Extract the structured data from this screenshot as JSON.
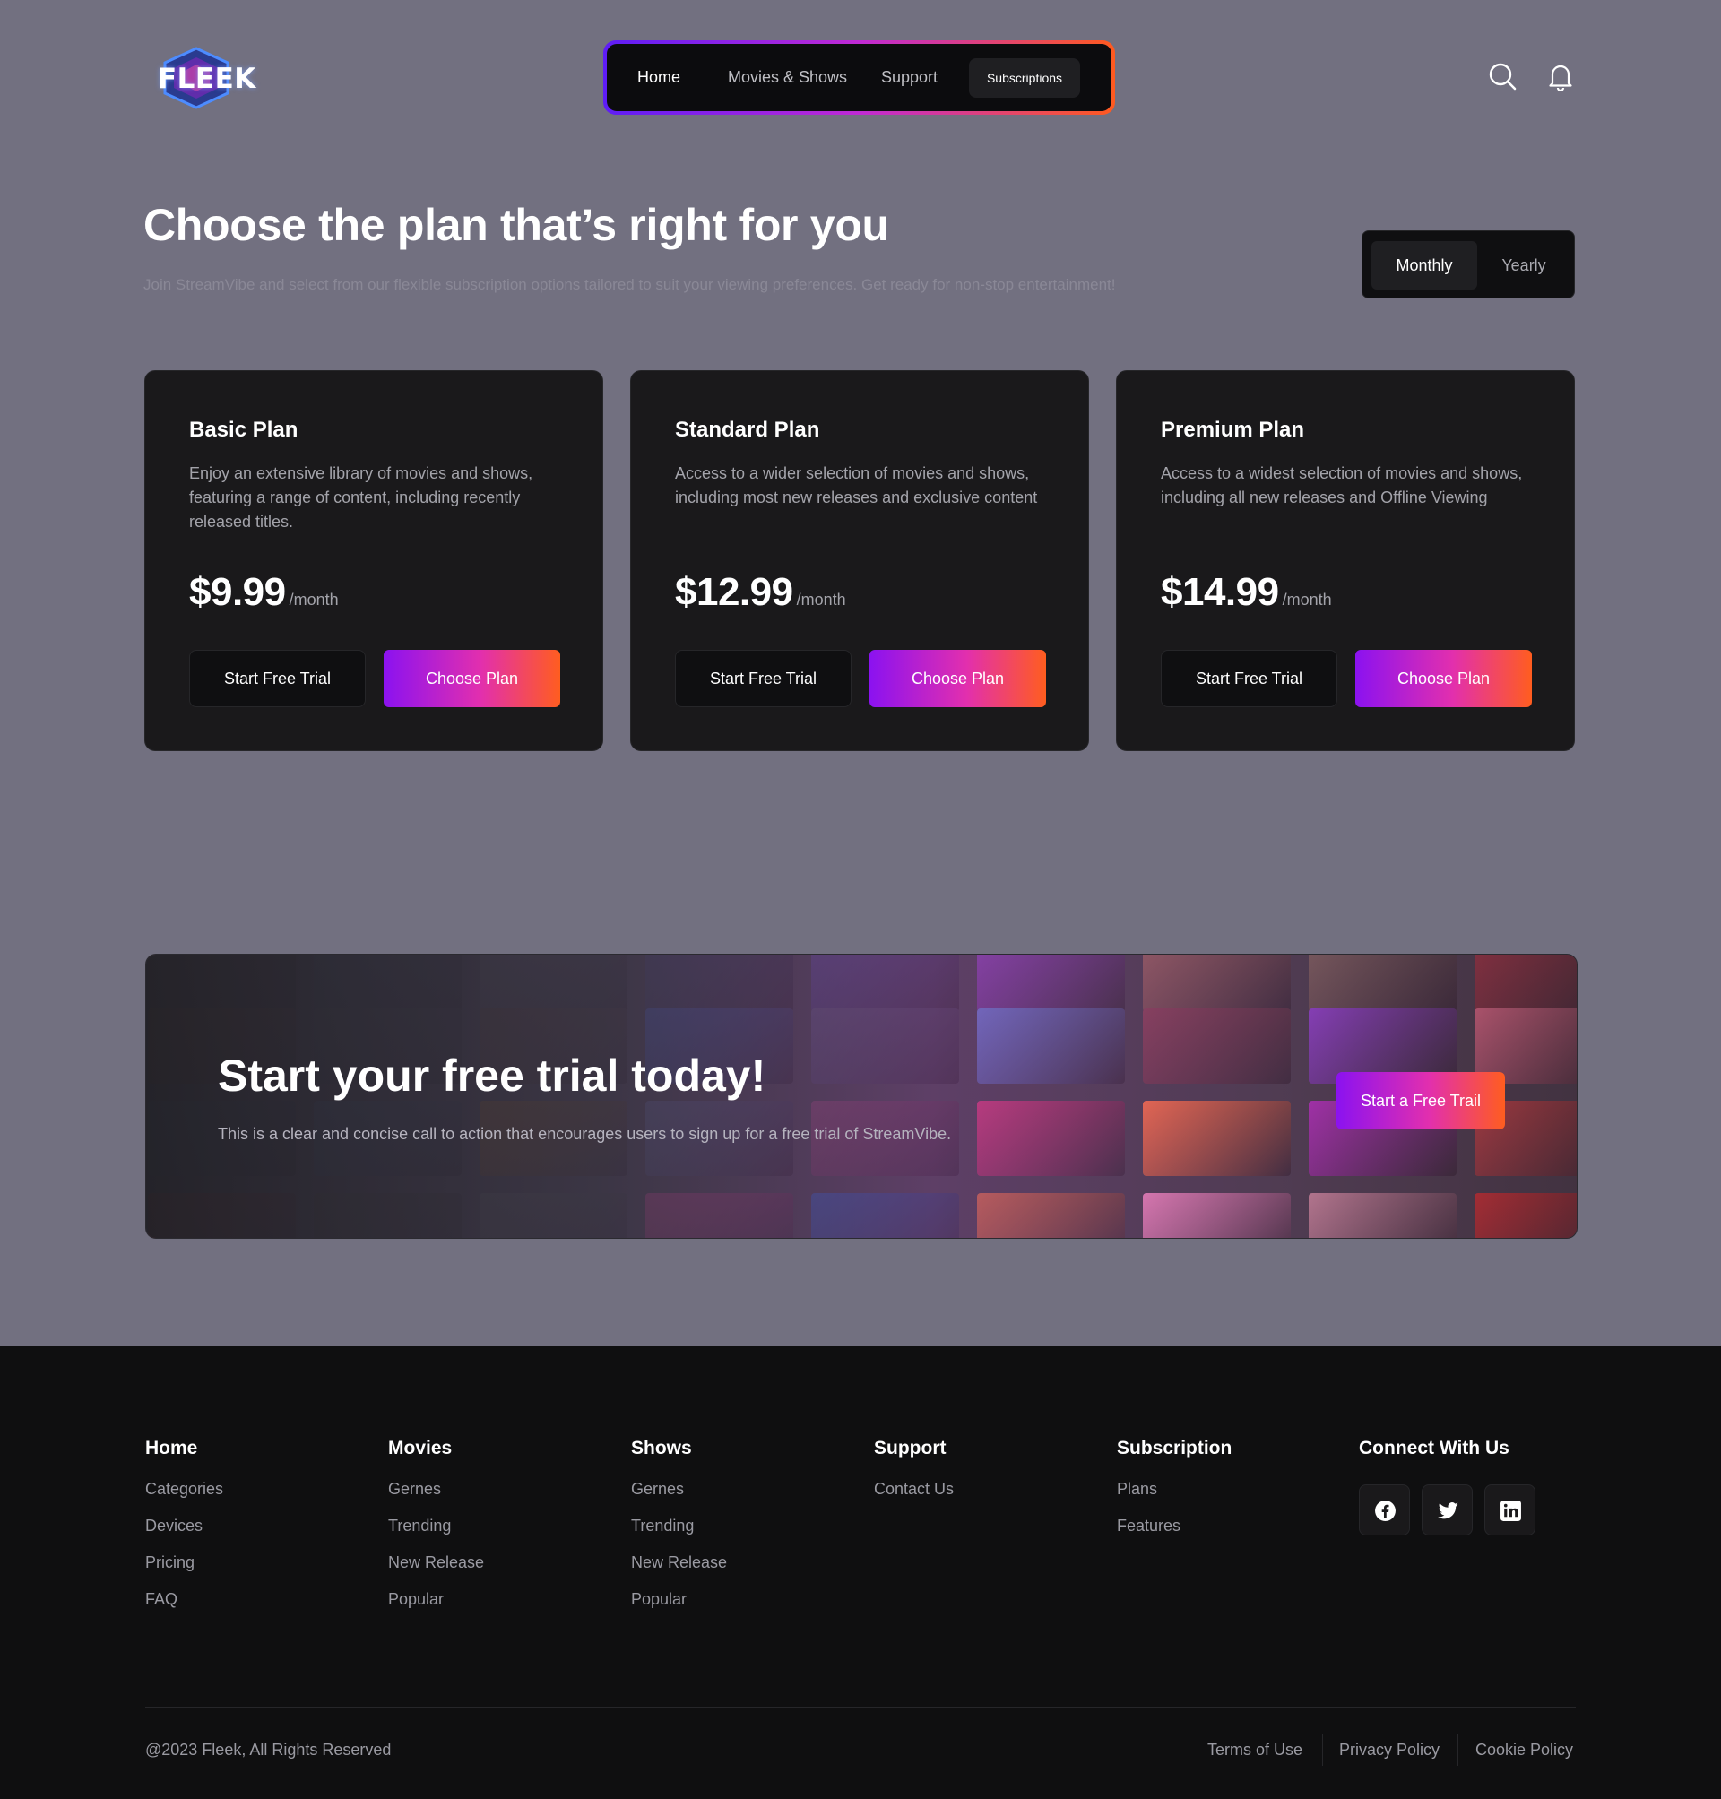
{
  "header": {
    "logo_text": "FLEEK",
    "nav": [
      {
        "label": "Home"
      },
      {
        "label": "Movies & Shows"
      },
      {
        "label": "Support"
      },
      {
        "label": "Subscriptions"
      }
    ],
    "icons": [
      "search-icon",
      "bell-icon"
    ],
    "colors": {
      "gradient_start": "#5e1df6",
      "gradient_mid": "#c02ad4",
      "gradient_end": "#ff5a1f"
    }
  },
  "hero": {
    "title": "Choose the plan that’s right for you",
    "subtitle": "Join StreamVibe and select from our flexible subscription options tailored to suit your viewing preferences. Get ready for non-stop entertainment!",
    "toggle": {
      "selected": "Monthly",
      "options": [
        "Monthly",
        "Yearly"
      ]
    }
  },
  "plans": [
    {
      "name": "Basic Plan",
      "description": "Enjoy an extensive library of movies and shows, featuring a range of content, including recently released titles.",
      "price": "$9.99",
      "period": "/month",
      "trial_label": "Start Free Trial",
      "choose_label": "Choose Plan"
    },
    {
      "name": "Standard Plan",
      "description": "Access to a wider selection of movies and shows, including most new releases and exclusive content",
      "price": "$12.99",
      "period": "/month",
      "trial_label": "Start Free Trial",
      "choose_label": "Choose Plan"
    },
    {
      "name": "Premium Plan",
      "description": "Access to a widest selection of movies and shows, including all new releases and Offline Viewing",
      "price": "$14.99",
      "period": "/month",
      "trial_label": "Start Free Trial",
      "choose_label": "Choose Plan"
    }
  ],
  "cta": {
    "title": "Start your free trial today!",
    "subtitle": "This is a clear and concise call to action that encourages users to sign up for a free trial of StreamVibe.",
    "button": "Start a Free Trail"
  },
  "footer": {
    "columns": [
      {
        "heading": "Home",
        "links": [
          "Categories",
          "Devices",
          "Pricing",
          "FAQ"
        ]
      },
      {
        "heading": "Movies",
        "links": [
          "Gernes",
          "Trending",
          "New Release",
          "Popular"
        ]
      },
      {
        "heading": "Shows",
        "links": [
          "Gernes",
          "Trending",
          "New Release",
          "Popular"
        ]
      },
      {
        "heading": "Support",
        "links": [
          "Contact Us"
        ]
      },
      {
        "heading": "Subscription",
        "links": [
          "Plans",
          "Features"
        ]
      },
      {
        "heading": "Connect With Us",
        "links": []
      }
    ],
    "socials": [
      "facebook-icon",
      "twitter-icon",
      "linkedin-icon"
    ],
    "copyright": "@2023 Fleek, All Rights Reserved",
    "legal": [
      "Terms of Use",
      "Privacy Policy",
      "Cookie Policy"
    ]
  }
}
